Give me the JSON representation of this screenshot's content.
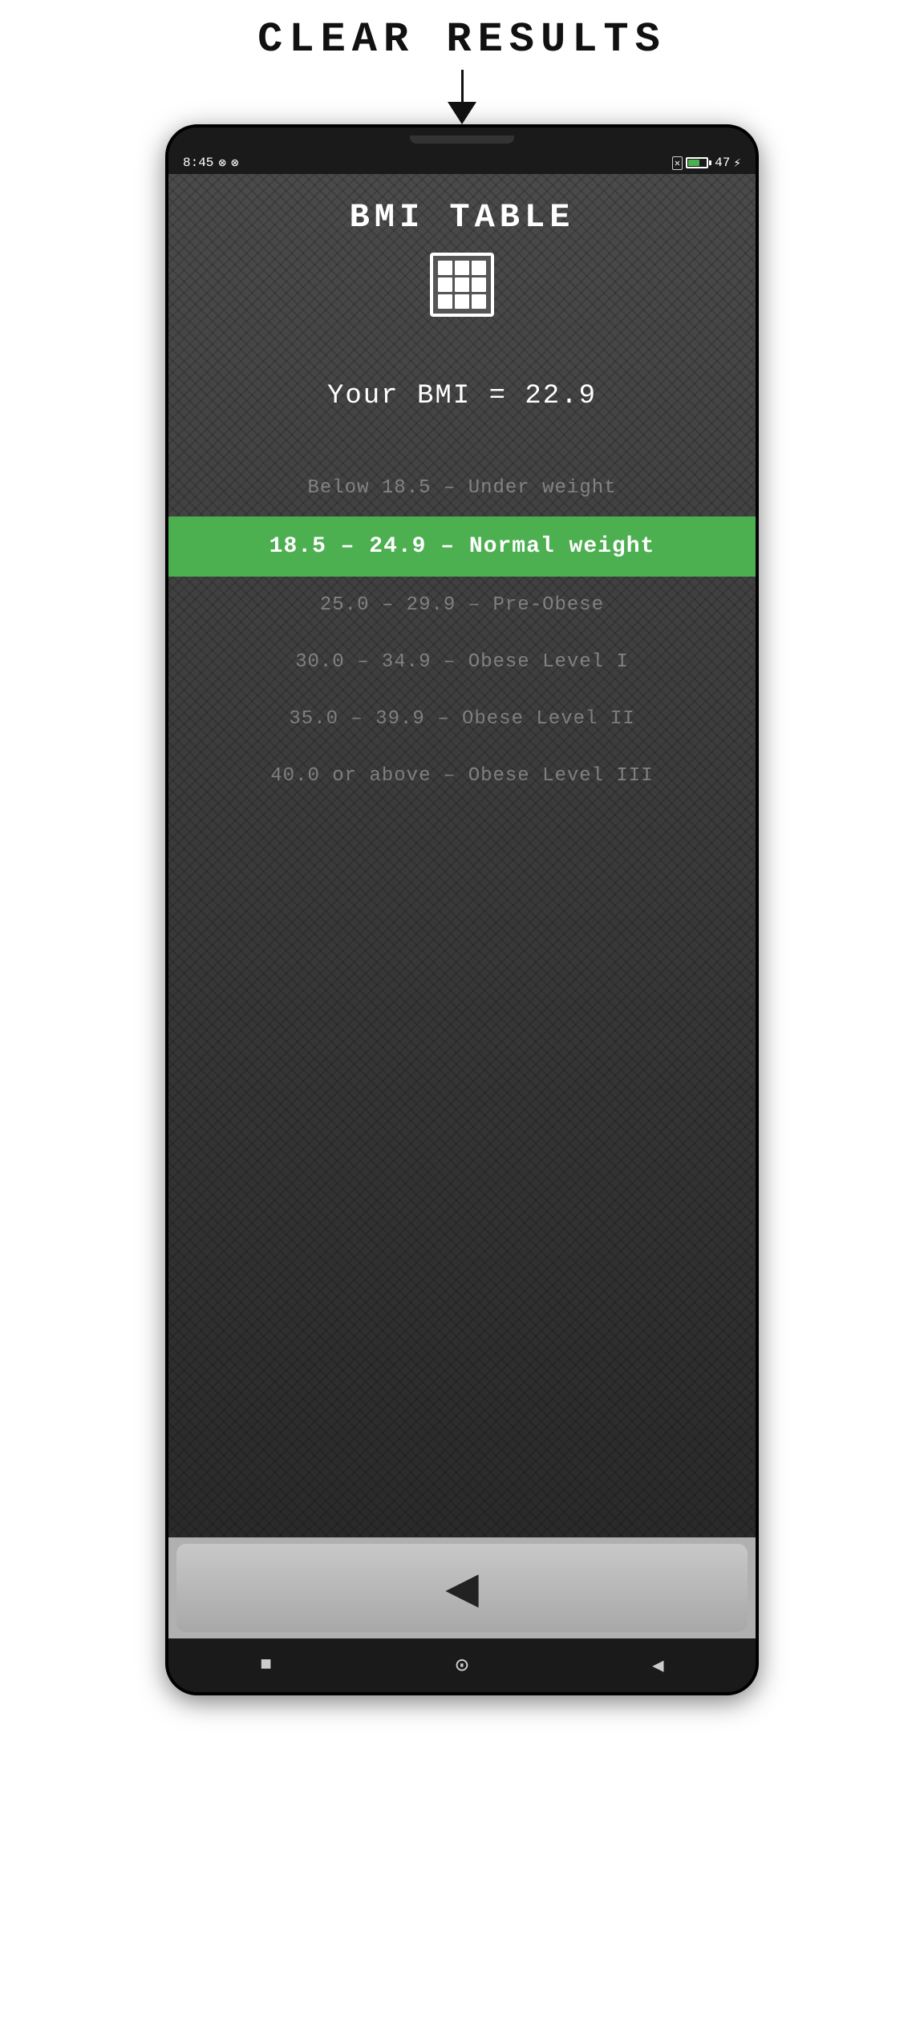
{
  "topBar": {
    "clearResultsLabel": "CLEAR   RESULTS"
  },
  "statusBar": {
    "time": "8:45",
    "icons": [
      "circle-notch",
      "circle-notch"
    ],
    "batteryPercent": "47",
    "charging": true
  },
  "screen": {
    "title": "BMI TABLE",
    "bmiResult": "Your BMI = 22.9",
    "categories": [
      {
        "label": "Below 18.5 – Under weight",
        "active": false
      },
      {
        "label": "18.5 – 24.9 – Normal weight",
        "active": true
      },
      {
        "label": "25.0 – 29.9 – Pre-Obese",
        "active": false
      },
      {
        "label": "30.0 – 34.9 – Obese Level I",
        "active": false
      },
      {
        "label": "35.0 – 39.9 – Obese Level II",
        "active": false
      },
      {
        "label": "40.0 or above – Obese Level III",
        "active": false
      }
    ]
  },
  "backButton": {
    "label": "◀"
  },
  "navBar": {
    "squareLabel": "■",
    "circleLabel": "⊙",
    "triangleLabel": "◀"
  },
  "colors": {
    "activeCategory": "#4caf50",
    "screenBg": "#3a3a3a",
    "phoneBg": "#1a1a1a"
  }
}
